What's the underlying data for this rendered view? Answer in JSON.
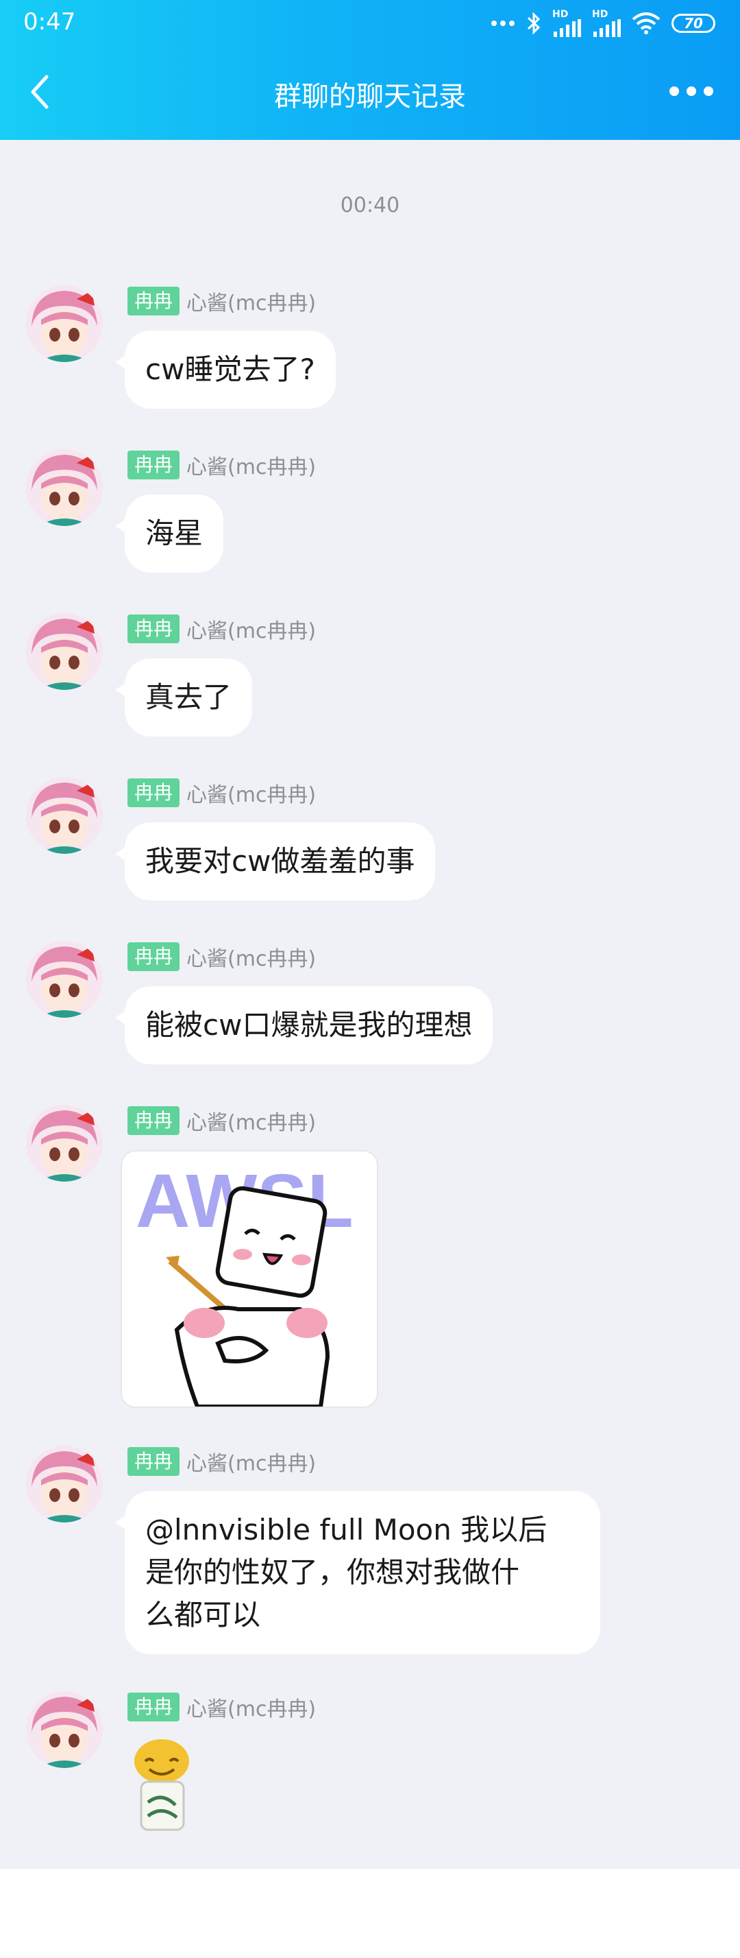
{
  "status_bar": {
    "time": "0:47",
    "battery": "70",
    "signal_labels": [
      "HD",
      "HD"
    ]
  },
  "header": {
    "title": "群聊的聊天记录",
    "back_icon": "chevron-left-icon",
    "more_icon": "more-dots-icon"
  },
  "timestamp": "00:40",
  "colors": {
    "header_start": "#17cdf6",
    "header_end": "#0a9cf5",
    "badge": "#5fd39a",
    "background": "#f0f1f6"
  },
  "messages": [
    {
      "badge": "冉冉",
      "sender": "心酱(mc冉冉)",
      "text": "cw睡觉去了?"
    },
    {
      "badge": "冉冉",
      "sender": "心酱(mc冉冉)",
      "text": "海星"
    },
    {
      "badge": "冉冉",
      "sender": "心酱(mc冉冉)",
      "text": "真去了"
    },
    {
      "badge": "冉冉",
      "sender": "心酱(mc冉冉)",
      "text": "我要对cw做羞羞的事"
    },
    {
      "badge": "冉冉",
      "sender": "心酱(mc冉冉)",
      "text": "能被cw口爆就是我的理想"
    },
    {
      "badge": "冉冉",
      "sender": "心酱(mc冉冉)",
      "sticker_text": "AWSL"
    },
    {
      "badge": "冉冉",
      "sender": "心酱(mc冉冉)",
      "text_lines": [
        "@lnnvisible full Moon 我以后",
        "是你的性奴了，你想对我做什",
        "么都可以"
      ]
    },
    {
      "badge": "冉冉",
      "sender": "心酱(mc冉冉)"
    }
  ]
}
